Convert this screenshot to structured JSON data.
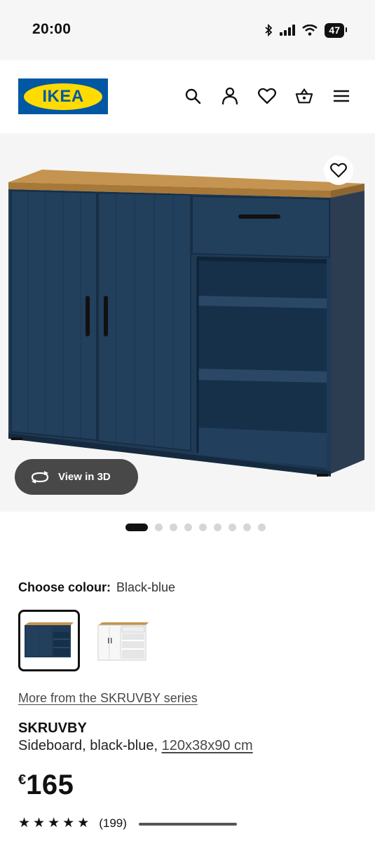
{
  "status_bar": {
    "time": "20:00",
    "battery": "47"
  },
  "header": {
    "logo_text": "IKEA"
  },
  "product_image": {
    "view_3d_label": "View in 3D",
    "gallery_total": 9,
    "gallery_active": 1
  },
  "colour": {
    "label": "Choose colour:",
    "value": "Black-blue",
    "options": [
      "black-blue",
      "white"
    ]
  },
  "series_link": "More from the SKRUVBY series",
  "product": {
    "name": "SKRUVBY",
    "description": "Sideboard, black-blue, ",
    "dimensions": "120x38x90 cm",
    "price_currency": "€",
    "price": "165",
    "rating": 5,
    "review_count": "(199)"
  },
  "colors": {
    "brand_blue": "#0058a3",
    "brand_yellow": "#ffdb00",
    "sideboard_blue": "#1f3a55",
    "wood": "#b98a4a"
  }
}
